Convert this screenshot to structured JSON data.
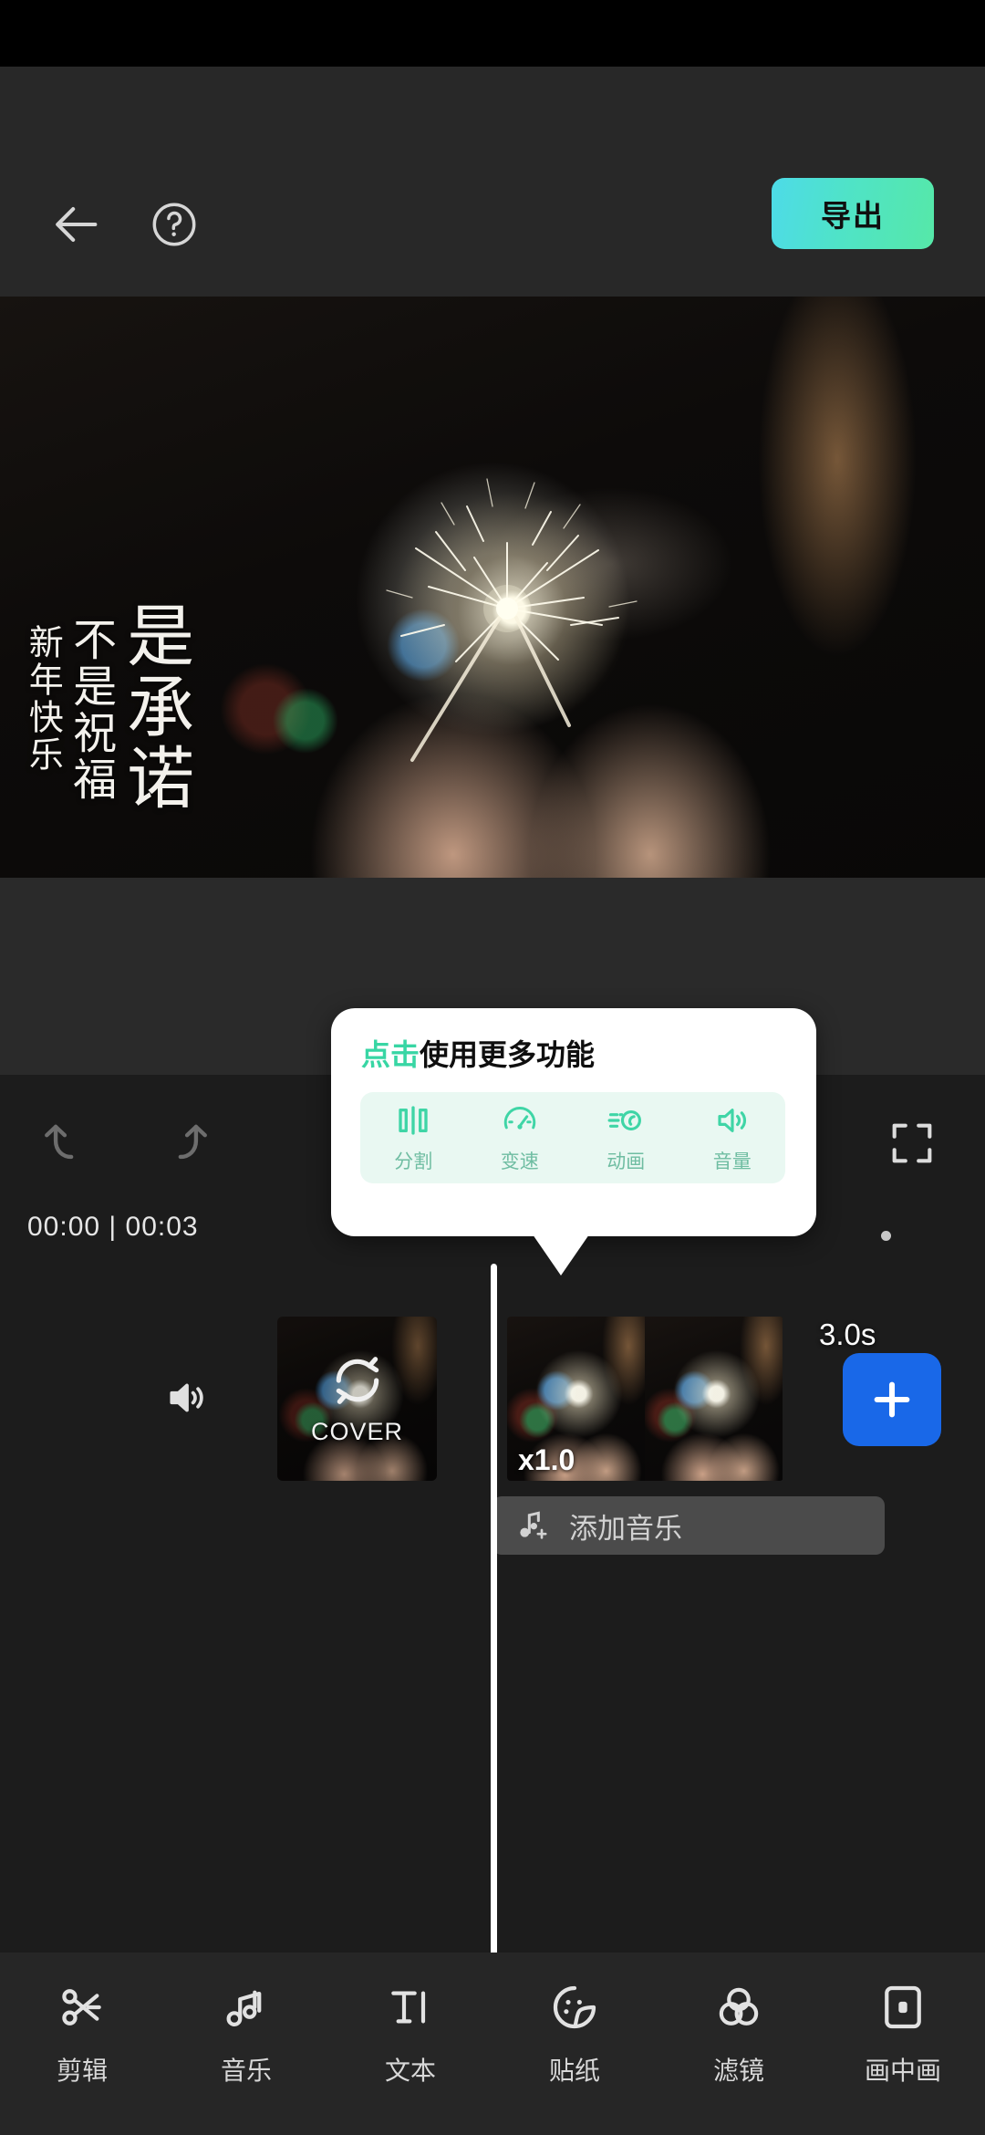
{
  "app": {
    "topbar": {
      "back_icon": "arrow-left-icon",
      "help_icon": "question-circle-icon",
      "export_label": "导出"
    },
    "preview": {
      "overlay_text_columns": [
        "是承诺",
        "不是祝福",
        "新年快乐"
      ]
    },
    "timeline_toolbar": {
      "undo_icon": "undo-icon",
      "redo_icon": "redo-icon",
      "fullscreen_icon": "fullscreen-icon",
      "timecode": "00:00 | 00:03"
    },
    "timeline": {
      "volume_icon": "volume-icon",
      "cover_label": "COVER",
      "cover_icon": "refresh-loop-icon",
      "speed_badge": "x1.0",
      "duration_badge": "3.0s",
      "add_clip_icon": "plus-icon",
      "add_music_label": "添加音乐",
      "add_music_icon": "music-note-plus-icon"
    },
    "tooltip": {
      "title_highlight": "点击",
      "title_rest": "使用更多功能",
      "highlight_color": "#38d6a4",
      "items": [
        {
          "icon": "split-icon",
          "label": "分割"
        },
        {
          "icon": "speed-gauge-icon",
          "label": "变速"
        },
        {
          "icon": "animation-icon",
          "label": "动画"
        },
        {
          "icon": "volume-icon",
          "label": "音量"
        }
      ]
    },
    "bottom_nav": [
      {
        "icon": "scissors-icon",
        "label": "剪辑"
      },
      {
        "icon": "music-note-icon",
        "label": "音乐"
      },
      {
        "icon": "text-icon",
        "label": "文本"
      },
      {
        "icon": "sticker-face-icon",
        "label": "贴纸"
      },
      {
        "icon": "filter-circles-icon",
        "label": "滤镜"
      },
      {
        "icon": "picture-in-picture-icon",
        "label": "画中画"
      }
    ],
    "colors": {
      "export_gradient_start": "#4ddbe8",
      "export_gradient_end": "#56e8a8",
      "add_clip_blue": "#1968e8",
      "tooltip_panel_bg": "#e9f8f2"
    }
  }
}
